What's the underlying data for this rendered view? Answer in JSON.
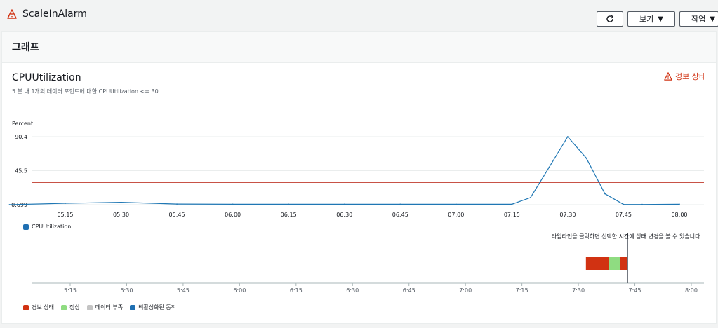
{
  "header": {
    "title": "ScaleInAlarm",
    "refresh_icon": "refresh-icon",
    "view_label": "보기",
    "actions_label": "작업"
  },
  "panel": {
    "title": "그래프"
  },
  "chart": {
    "title": "CPUUtilization",
    "subtitle": "5 분 내 1개의 데이터 포인트에 대한 CPUUtilization <= 30",
    "status_label": "경보 상태",
    "colors": {
      "line": "#1f77b4",
      "threshold": "#c0392b",
      "alarm": "#d13212",
      "ok": "#8fdc81",
      "insufficient": "#c4c4c4",
      "disabled": "#1f6fb2"
    }
  },
  "chart_data": {
    "type": "line",
    "ylabel": "Percent",
    "yticks": [
      "90.4",
      "45.5",
      "0.699"
    ],
    "ylim": [
      0.699,
      90.4
    ],
    "xticks": [
      "05:15",
      "05:30",
      "05:45",
      "06:00",
      "06:15",
      "06:30",
      "06:45",
      "07:00",
      "07:15",
      "07:30",
      "07:45",
      "08:00"
    ],
    "threshold": 30,
    "series": [
      {
        "name": "CPUUtilization",
        "x": [
          "05:00",
          "05:15",
          "05:30",
          "05:45",
          "06:00",
          "06:15",
          "06:30",
          "06:45",
          "07:00",
          "07:15",
          "07:20",
          "07:25",
          "07:30",
          "07:35",
          "07:40",
          "07:45",
          "07:50",
          "08:00"
        ],
        "values": [
          0.699,
          2.5,
          3.8,
          1.5,
          1.3,
          1.3,
          1.3,
          1.3,
          1.3,
          1.3,
          10.0,
          50.0,
          90.4,
          62.0,
          15.0,
          1.0,
          1.0,
          1.3
        ]
      }
    ],
    "legend": "bottom-left"
  },
  "timeline": {
    "hint": "타임라인을 클릭하면 선택한 시간에 상태 변경을 볼 수 있습니다.",
    "xticks": [
      "5:15",
      "5:30",
      "5:45",
      "6:00",
      "6:15",
      "6:30",
      "6:45",
      "7:00",
      "7:15",
      "7:30",
      "7:45",
      "8:00"
    ],
    "segments": [
      {
        "state": "alarm",
        "start": "07:32",
        "end": "07:38"
      },
      {
        "state": "ok",
        "start": "07:38",
        "end": "07:41"
      },
      {
        "state": "alarm",
        "start": "07:41",
        "end": "07:43"
      }
    ],
    "legend": [
      "경보 상태",
      "정상",
      "데이터 부족",
      "비활성화된 동작"
    ]
  }
}
